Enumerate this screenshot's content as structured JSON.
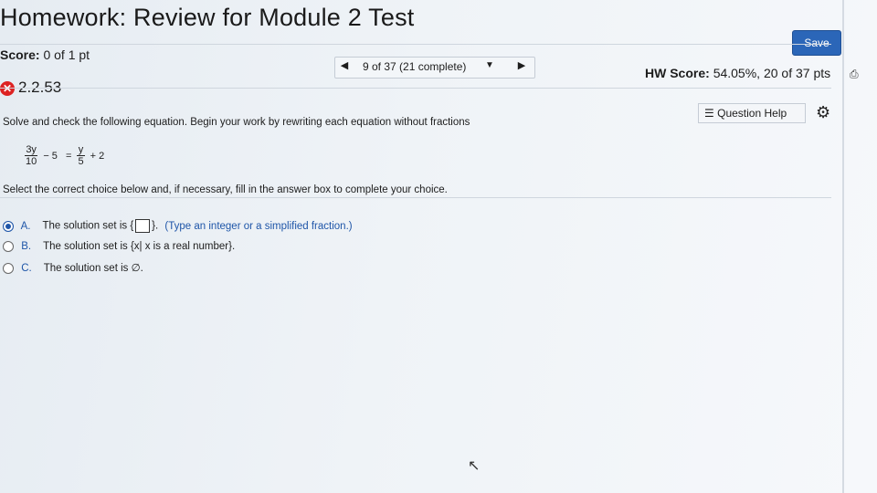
{
  "header": {
    "title": "Homework: Review for Module 2 Test",
    "save_label": "Save"
  },
  "score": {
    "label": "Score:",
    "value": "0 of 1 pt"
  },
  "question_nav": {
    "prev_icon": "triangle-left",
    "label": "9 of 37 (21 complete)",
    "dropdown_icon": "triangle-down",
    "next_icon": "triangle-right"
  },
  "hw_score": {
    "label": "HW Score:",
    "value": "54.05%, 20 of 37 pts"
  },
  "question": {
    "number": "2.2.53",
    "status_icon": "x-circle-red"
  },
  "help": {
    "label": "Question Help"
  },
  "instructions": "Solve and check the following equation. Begin your work by rewriting each equation without fractions",
  "equation": {
    "left_num": "3y",
    "left_den": "10",
    "minus": "− 5",
    "equals": "=",
    "right_num": "y",
    "right_den": "5",
    "plus": "+ 2"
  },
  "select_prompt": "Select the correct choice below and, if necessary, fill in the answer box to complete your choice.",
  "choices": [
    {
      "letter": "A.",
      "text_before": "The solution set is",
      "text_after": ".",
      "hint": "(Type an integer or a simplified fraction.)",
      "selected": true
    },
    {
      "letter": "B.",
      "text": "The solution set is {x| x is a real number}.",
      "selected": false
    },
    {
      "letter": "C.",
      "text": "The solution set is ∅.",
      "selected": false
    }
  ],
  "colors": {
    "accent": "#2b66b8",
    "error": "#dd2222",
    "link": "#1e55a8"
  }
}
